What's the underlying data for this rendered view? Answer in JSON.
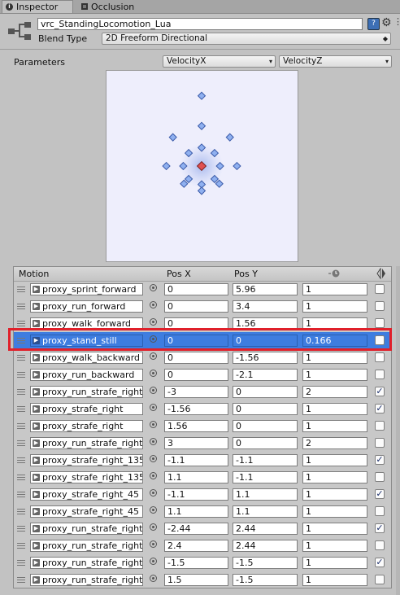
{
  "tabs": [
    {
      "label": "Inspector",
      "icon": "info-icon"
    },
    {
      "label": "Occlusion",
      "icon": "occlusion-icon"
    }
  ],
  "header": {
    "object_name": "vrc_StandingLocomotion_Lua",
    "blend_type_label": "Blend Type",
    "blend_type_value": "2D Freeform Directional"
  },
  "parameters": {
    "label": "Parameters",
    "x_param": "VelocityX",
    "y_param": "VelocityZ"
  },
  "colors": {
    "selected_row": "#3e7de0",
    "highlight_box": "#e0202a",
    "plot_background": "#eeeefc",
    "point": "#8fb0f0",
    "active_point": "#e05050"
  },
  "motion_table": {
    "columns": [
      "Motion",
      "Pos X",
      "Pos Y"
    ],
    "rows": [
      {
        "clip": "proxy_sprint_forward",
        "pos_x": "0",
        "pos_y": "5.96",
        "speed": "1",
        "mirror": false
      },
      {
        "clip": "proxy_run_forward",
        "pos_x": "0",
        "pos_y": "3.4",
        "speed": "1",
        "mirror": false
      },
      {
        "clip": "proxy_walk_forward",
        "pos_x": "0",
        "pos_y": "1.56",
        "speed": "1",
        "mirror": false
      },
      {
        "clip": "proxy_stand_still",
        "pos_x": "0",
        "pos_y": "0",
        "speed": "0.166",
        "mirror": false,
        "selected": true
      },
      {
        "clip": "proxy_walk_backward",
        "pos_x": "0",
        "pos_y": "-1.56",
        "speed": "1",
        "mirror": false
      },
      {
        "clip": "proxy_run_backward",
        "pos_x": "0",
        "pos_y": "-2.1",
        "speed": "1",
        "mirror": false
      },
      {
        "clip": "proxy_run_strafe_right",
        "pos_x": "-3",
        "pos_y": "0",
        "speed": "2",
        "mirror": true
      },
      {
        "clip": "proxy_strafe_right",
        "pos_x": "-1.56",
        "pos_y": "0",
        "speed": "1",
        "mirror": true
      },
      {
        "clip": "proxy_strafe_right",
        "pos_x": "1.56",
        "pos_y": "0",
        "speed": "1",
        "mirror": false
      },
      {
        "clip": "proxy_run_strafe_right",
        "pos_x": "3",
        "pos_y": "0",
        "speed": "2",
        "mirror": false
      },
      {
        "clip": "proxy_strafe_right_135",
        "pos_x": "-1.1",
        "pos_y": "-1.1",
        "speed": "1",
        "mirror": true
      },
      {
        "clip": "proxy_strafe_right_135",
        "pos_x": "1.1",
        "pos_y": "-1.1",
        "speed": "1",
        "mirror": false
      },
      {
        "clip": "proxy_strafe_right_45",
        "pos_x": "-1.1",
        "pos_y": "1.1",
        "speed": "1",
        "mirror": true
      },
      {
        "clip": "proxy_strafe_right_45",
        "pos_x": "1.1",
        "pos_y": "1.1",
        "speed": "1",
        "mirror": false
      },
      {
        "clip": "proxy_run_strafe_right",
        "pos_x": "-2.44",
        "pos_y": "2.44",
        "speed": "1",
        "mirror": true
      },
      {
        "clip": "proxy_run_strafe_right",
        "pos_x": "2.4",
        "pos_y": "2.44",
        "speed": "1",
        "mirror": false
      },
      {
        "clip": "proxy_run_strafe_right",
        "pos_x": "-1.5",
        "pos_y": "-1.5",
        "speed": "1",
        "mirror": true
      },
      {
        "clip": "proxy_run_strafe_right",
        "pos_x": "1.5",
        "pos_y": "-1.5",
        "speed": "1",
        "mirror": false
      }
    ]
  }
}
